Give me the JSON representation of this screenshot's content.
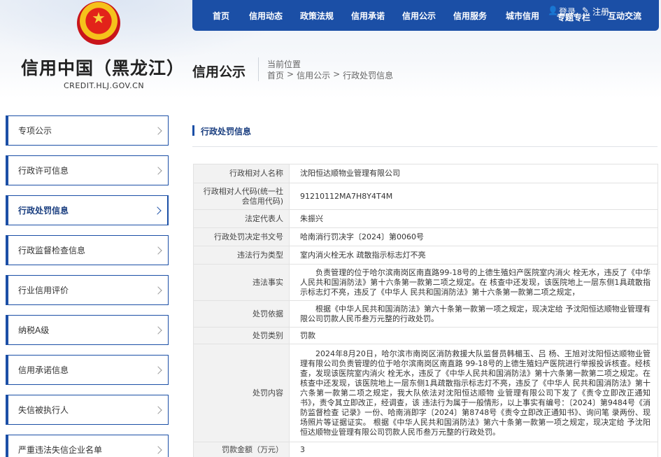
{
  "site": {
    "title": "信用中国（黑龙江）",
    "domain": "CREDIT.HLJ.GOV.CN",
    "emblem_icon": "national-emblem-icon"
  },
  "nav": {
    "items": [
      "首页",
      "信用动态",
      "政策法规",
      "信用承诺",
      "信用公示",
      "信用服务",
      "城市信用",
      "专题专栏",
      "互动交流"
    ],
    "login": "登录",
    "register": "注册"
  },
  "section": {
    "title": "信用公示",
    "position_label": "当前位置",
    "breadcrumb": [
      "首页",
      ">",
      "信用公示",
      ">",
      "行政处罚信息"
    ]
  },
  "sidebar": {
    "items": [
      {
        "label": "专项公示",
        "active": false
      },
      {
        "label": "行政许可信息",
        "active": false
      },
      {
        "label": "行政处罚信息",
        "active": true
      },
      {
        "label": "行政监督检查信息",
        "active": false
      },
      {
        "label": "行业信用评价",
        "active": false
      },
      {
        "label": "纳税A级",
        "active": false
      },
      {
        "label": "信用承诺信息",
        "active": false
      },
      {
        "label": "失信被执行人",
        "active": false
      },
      {
        "label": "严重违法失信企业名单",
        "active": false
      }
    ]
  },
  "main": {
    "heading": "行政处罚信息",
    "rows": [
      {
        "key": "行政相对人名称",
        "value": "沈阳恒达顺物业管理有限公司"
      },
      {
        "key": "行政相对人代码(统一社会信用代码)",
        "value": "91210112MA7H8Y4T4M"
      },
      {
        "key": "法定代表人",
        "value": "朱振兴"
      },
      {
        "key": "行政处罚决定书文号",
        "value": "哈南消行罚决字〔2024〕第0060号"
      },
      {
        "key": "违法行为类型",
        "value": "室内消火栓无水 疏散指示标志灯不亮"
      },
      {
        "key": "违法事实",
        "value": "负责管理的位于哈尔滨南岗区南直路99-18号的上德生殖妇产医院室内消火 栓无水，违反了《中华人民共和国消防法》第十六条第一款第二项之规定。在 核查中还发现，该医院地上一层东侧1具疏散指示标志灯不亮，违反了《中华人 民共和国消防法》第十六条第一款第二项之规定，"
      },
      {
        "key": "处罚依据",
        "value": "根据《中华人民共和国消防法》第六十条第一款第一项之规定，现决定给 予沈阳恒达顺物业管理有限公司罚款人民币叁万元整的行政处罚。"
      },
      {
        "key": "处罚类别",
        "value": "罚款"
      },
      {
        "key": "处罚内容",
        "value": "2024年8月20日，哈尔滨市南岗区消防救援大队监督员韩楣玉、吕 杨、王旭对沈阳恒达顺物业管理有限公司负责管理的位于哈尔滨南岗区南直路 99-18号的上德生殖妇产医院进行举报投诉核查。经核查，发现该医院室内消火 栓无水，违反了《中华人民共和国消防法》第十六条第一款第二项之规定。在 核查中还发现，该医院地上一层东侧1具疏散指示标志灯不亮，违反了《中华人 民共和国消防法》第十六条第一款第二项之规定，我大队依法对沈阳恒达顺物 业管理有限公司下发了《责令立即改正通知书》，责令其立即改正，经调查，该 违法行为属于一般情形，以上事实有编号：〔2024〕第9484号《消防监督检查 记录》一份、哈南消即字〔2024〕第8748号《责令立即改正通知书》、询问笔 录两份、现场照片等证据证实。 根据《中华人民共和国消防法》第六十条第一款第一项之规定，现决定给 予沈阳恒达顺物业管理有限公司罚款人民币叁万元整的行政处罚。"
      },
      {
        "key": "罚款金额（万元）",
        "value": "3"
      }
    ]
  }
}
